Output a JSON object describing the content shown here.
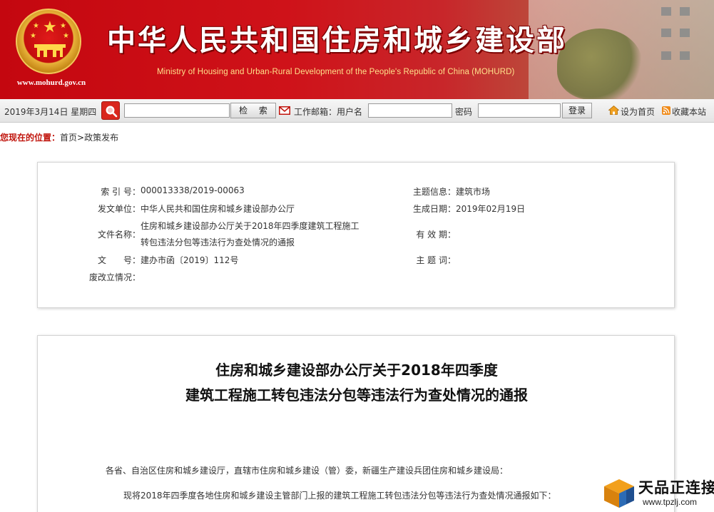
{
  "banner": {
    "title": "中华人民共和国住房和城乡建设部",
    "subtitle": "Ministry of Housing and Urban-Rural Development of the People's Republic of China (MOHURD)",
    "url": "www.mohurd.gov.cn",
    "colors": {
      "primary_red": "#c4070f",
      "title_shadow": "#7a0000",
      "subtitle_gold": "#ffe08a"
    }
  },
  "toolbar": {
    "date": "2019年3月14日 星期四",
    "search_icon": "magnifier-icon",
    "search_value": "",
    "search_button": "检 索",
    "mail_icon": "envelope-icon",
    "mail_label": "工作邮箱：用户名",
    "username_value": "",
    "password_label": "密码",
    "password_value": "",
    "login_button": "登录",
    "home_icon": "home-icon",
    "set_home": "设为首页",
    "rss_icon": "rss-icon",
    "bookmark": "收藏本站"
  },
  "breadcrumb": {
    "label": "您现在的位置：",
    "home": "首页",
    "separator": ">",
    "current": "政策发布"
  },
  "info": {
    "index_label": "索 引 号：",
    "index_value": "000013338/2019-00063",
    "topic_label": "主题信息：",
    "topic_value": "建筑市场",
    "issuer_label": "发文单位：",
    "issuer_value": "中华人民共和国住房和城乡建设部办公厅",
    "date_label": "生成日期：",
    "date_value": "2019年02月19日",
    "filename_label": "文件名称：",
    "filename_line1": "住房和城乡建设部办公厅关于2018年四季度建筑工程施工",
    "filename_line2": "转包违法分包等违法行为查处情况的通报",
    "validity_label": "有 效 期：",
    "validity_value": "",
    "docno_label": "文　　号：",
    "docno_value": "建办市函〔2019〕112号",
    "keyword_label": "主 题 词：",
    "keyword_value": "",
    "status_label": "废改立情况：",
    "status_value": ""
  },
  "article": {
    "title_line1": "住房和城乡建设部办公厅关于2018年四季度",
    "title_line2": "建筑工程施工转包违法分包等违法行为查处情况的通报",
    "salutation": "各省、自治区住房和城乡建设厅，直辖市住房和城乡建设（管）委，新疆生产建设兵团住房和城乡建设局：",
    "paragraph": "现将2018年四季度各地住房和城乡建设主管部门上报的建筑工程施工转包违法分包等违法行为查处情况通报如下："
  },
  "watermark": {
    "name": "天品正连接",
    "url": "www.tpzlj.com",
    "logo_icon": "cube-logo-icon"
  }
}
